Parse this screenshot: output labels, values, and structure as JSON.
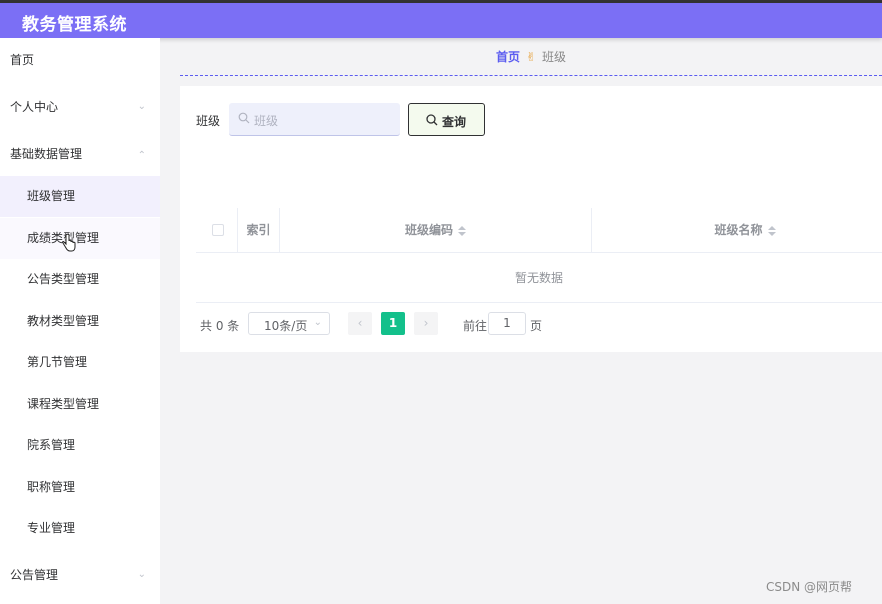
{
  "app": {
    "title": "教务管理系统"
  },
  "sidebar": {
    "home": "首页",
    "personal_center": "个人中心",
    "basic_data": "基础数据管理",
    "sub_items": [
      "班级管理",
      "成绩类型管理",
      "公告类型管理",
      "教材类型管理",
      "第几节管理",
      "课程类型管理",
      "院系管理",
      "职称管理",
      "专业管理"
    ],
    "active_index": 0,
    "announcement": "公告管理"
  },
  "breadcrumb": {
    "home": "首页",
    "separator": "✌",
    "current": "班级"
  },
  "search": {
    "label": "班级",
    "placeholder": "班级",
    "button_label": "查询"
  },
  "table": {
    "columns": [
      "索引",
      "班级编码",
      "班级名称"
    ],
    "empty_text": "暂无数据"
  },
  "pagination": {
    "total_text": "共 0 条",
    "page_size": "10条/页",
    "current_page": "1",
    "goto_prefix": "前往",
    "goto_value": "1",
    "goto_suffix": "页",
    "prev_icon": "‹",
    "next_icon": "›"
  },
  "watermark": "CSDN @网页帮",
  "colors": {
    "header": "#7b6ff5",
    "accent": "#5b5cf0",
    "pager_active": "#13c08b"
  }
}
